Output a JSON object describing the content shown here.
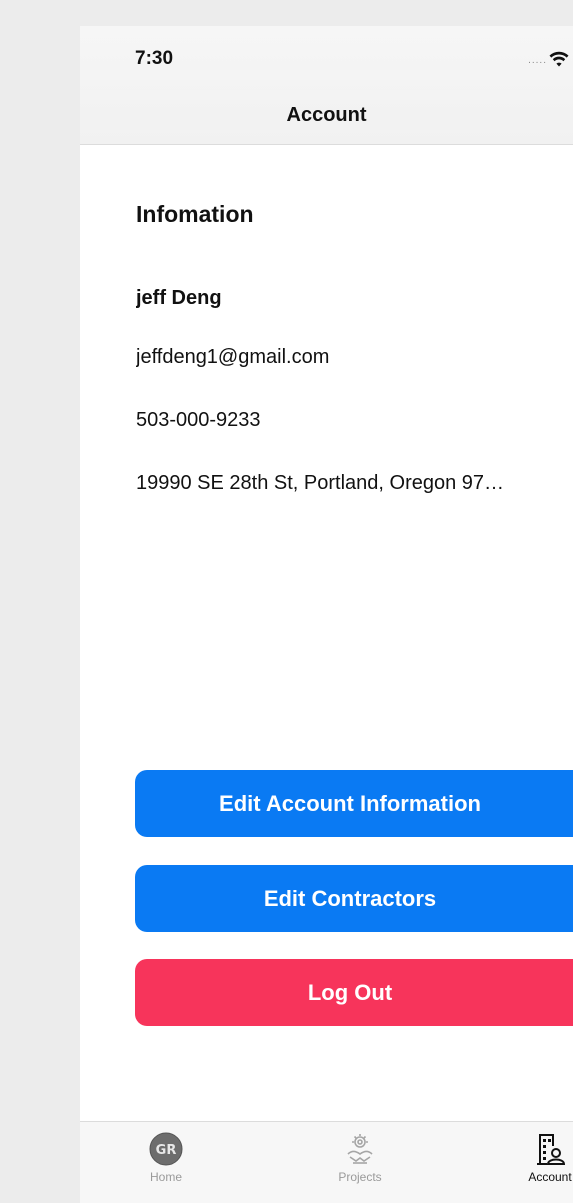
{
  "status_bar": {
    "time": "7:30",
    "signal": "....."
  },
  "nav": {
    "title": "Account"
  },
  "info": {
    "section_title": "Infomation",
    "name": "jeff Deng",
    "email": "jeffdeng1@gmail.com",
    "phone": "503-000-9233",
    "address": "19990 SE 28th St, Portland, Oregon 97…"
  },
  "actions": {
    "edit_account_label": "Edit Account Information",
    "edit_contractors_label": "Edit Contractors",
    "logout_label": "Log Out"
  },
  "tabs": [
    {
      "label": "Home",
      "icon": "ga-logo-icon",
      "active": false
    },
    {
      "label": "Projects",
      "icon": "projects-icon",
      "active": false
    },
    {
      "label": "Account",
      "icon": "building-user-icon",
      "active": true
    }
  ],
  "colors": {
    "primary_button": "#0a7af3",
    "danger_button": "#f7345b",
    "tab_active": "#111111",
    "tab_inactive": "#9a9a9a"
  }
}
